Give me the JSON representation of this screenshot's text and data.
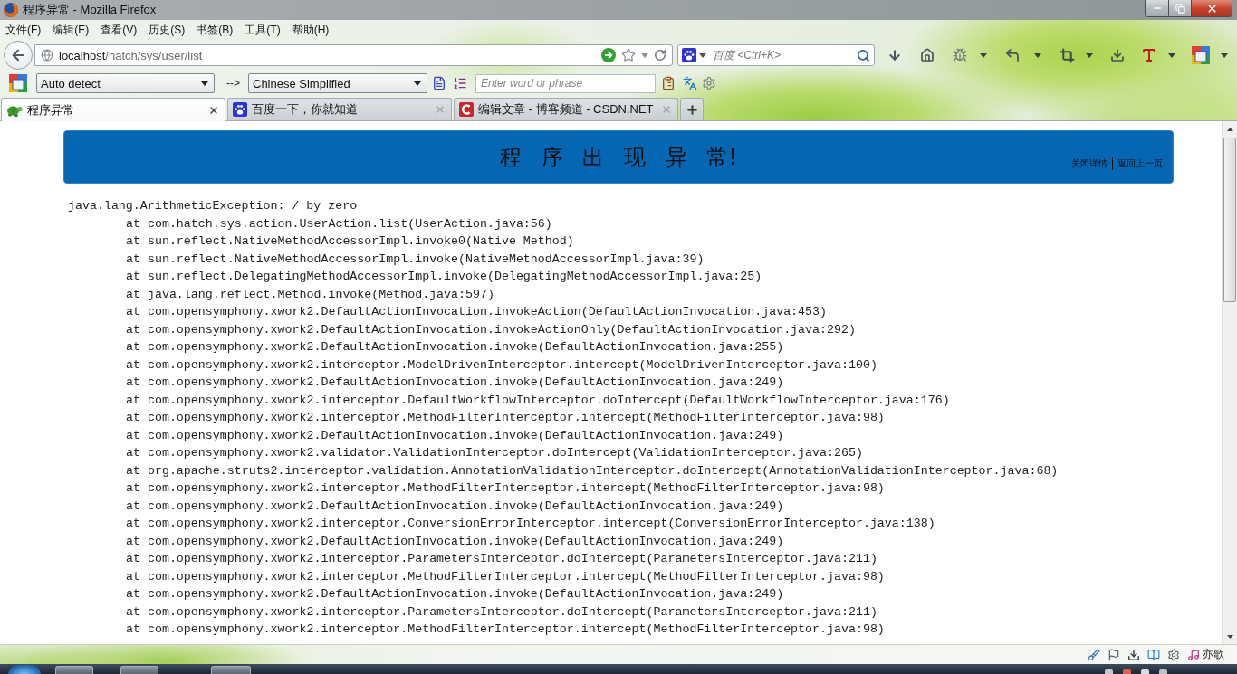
{
  "window": {
    "title": "程序异常 - Mozilla Firefox"
  },
  "menu_bar": [
    "文件(F)",
    "编辑(E)",
    "查看(V)",
    "历史(S)",
    "书签(B)",
    "工具(T)",
    "帮助(H)"
  ],
  "address_bar": {
    "host": "localhost",
    "path": "/hatch/sys/user/list"
  },
  "search_box": {
    "placeholder": "百度 <Ctrl+K>"
  },
  "translate_bar": {
    "source_language": "Auto detect",
    "arrow": "-->",
    "target_language": "Chinese Simplified",
    "word_field": {
      "placeholder": "Enter word or phrase"
    }
  },
  "tabs": [
    {
      "title": "程序异常",
      "selected": true
    },
    {
      "title": "百度一下，你就知道",
      "selected": false
    },
    {
      "title": "编辑文章 - 博客频道 - CSDN.NET",
      "selected": false
    }
  ],
  "page": {
    "heading": "程 序 出 现 异 常!",
    "links": [
      "关闭详情",
      "返回上一页"
    ],
    "exception": {
      "message": "java.lang.ArithmeticException: / by zero",
      "frames": [
        "at com.hatch.sys.action.UserAction.list(UserAction.java:56)",
        "at sun.reflect.NativeMethodAccessorImpl.invoke0(Native Method)",
        "at sun.reflect.NativeMethodAccessorImpl.invoke(NativeMethodAccessorImpl.java:39)",
        "at sun.reflect.DelegatingMethodAccessorImpl.invoke(DelegatingMethodAccessorImpl.java:25)",
        "at java.lang.reflect.Method.invoke(Method.java:597)",
        "at com.opensymphony.xwork2.DefaultActionInvocation.invokeAction(DefaultActionInvocation.java:453)",
        "at com.opensymphony.xwork2.DefaultActionInvocation.invokeActionOnly(DefaultActionInvocation.java:292)",
        "at com.opensymphony.xwork2.DefaultActionInvocation.invoke(DefaultActionInvocation.java:255)",
        "at com.opensymphony.xwork2.interceptor.ModelDrivenInterceptor.intercept(ModelDrivenInterceptor.java:100)",
        "at com.opensymphony.xwork2.DefaultActionInvocation.invoke(DefaultActionInvocation.java:249)",
        "at com.opensymphony.xwork2.interceptor.DefaultWorkflowInterceptor.doIntercept(DefaultWorkflowInterceptor.java:176)",
        "at com.opensymphony.xwork2.interceptor.MethodFilterInterceptor.intercept(MethodFilterInterceptor.java:98)",
        "at com.opensymphony.xwork2.DefaultActionInvocation.invoke(DefaultActionInvocation.java:249)",
        "at com.opensymphony.xwork2.validator.ValidationInterceptor.doIntercept(ValidationInterceptor.java:265)",
        "at org.apache.struts2.interceptor.validation.AnnotationValidationInterceptor.doIntercept(AnnotationValidationInterceptor.java:68)",
        "at com.opensymphony.xwork2.interceptor.MethodFilterInterceptor.intercept(MethodFilterInterceptor.java:98)",
        "at com.opensymphony.xwork2.DefaultActionInvocation.invoke(DefaultActionInvocation.java:249)",
        "at com.opensymphony.xwork2.interceptor.ConversionErrorInterceptor.intercept(ConversionErrorInterceptor.java:138)",
        "at com.opensymphony.xwork2.DefaultActionInvocation.invoke(DefaultActionInvocation.java:249)",
        "at com.opensymphony.xwork2.interceptor.ParametersInterceptor.doIntercept(ParametersInterceptor.java:211)",
        "at com.opensymphony.xwork2.interceptor.MethodFilterInterceptor.intercept(MethodFilterInterceptor.java:98)",
        "at com.opensymphony.xwork2.DefaultActionInvocation.invoke(DefaultActionInvocation.java:249)",
        "at com.opensymphony.xwork2.interceptor.ParametersInterceptor.doIntercept(ParametersInterceptor.java:211)",
        "at com.opensymphony.xwork2.interceptor.MethodFilterInterceptor.intercept(MethodFilterInterceptor.java:98)"
      ]
    }
  },
  "status_bar": {
    "music_label": "亦歌"
  }
}
